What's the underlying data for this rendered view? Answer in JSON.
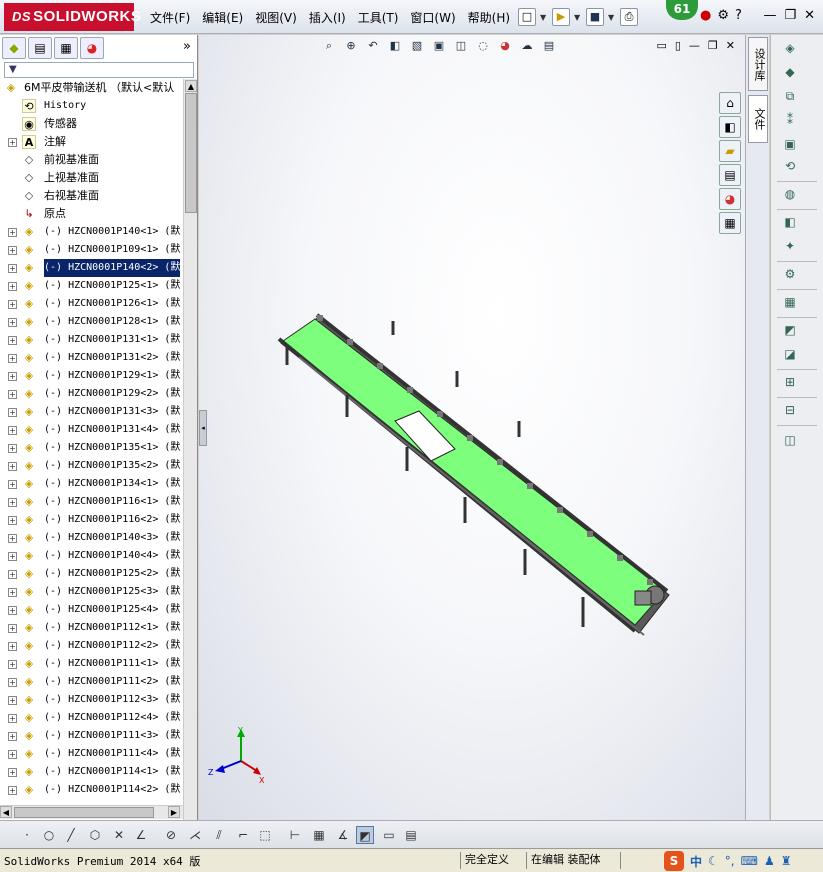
{
  "app": {
    "brand": "SOLIDWORKS",
    "brand_prefix": "DS"
  },
  "menus": [
    "文件(F)",
    "编辑(E)",
    "视图(V)",
    "插入(I)",
    "工具(T)",
    "窗口(W)",
    "帮助(H)"
  ],
  "badge": "61",
  "tree": {
    "root": "6M平皮带输送机 （默认<默认",
    "features": [
      {
        "icon": "history-icon",
        "label": "History"
      },
      {
        "icon": "sensor-icon",
        "label": "传感器"
      },
      {
        "icon": "annotation-icon",
        "label": "注解"
      },
      {
        "icon": "plane-icon",
        "label": "前视基准面"
      },
      {
        "icon": "plane-icon",
        "label": "上视基准面"
      },
      {
        "icon": "plane-icon",
        "label": "右视基准面"
      },
      {
        "icon": "origin-icon",
        "label": "原点"
      }
    ],
    "components": [
      "(-) HZCN0001P140<1> (默",
      "(-) HZCN0001P109<1> (默",
      "(-) HZCN0001P140<2> (默",
      "(-) HZCN0001P125<1> (默",
      "(-) HZCN0001P126<1> (默",
      "(-) HZCN0001P128<1> (默",
      "(-) HZCN0001P131<1> (默",
      "(-) HZCN0001P131<2> (默",
      "(-) HZCN0001P129<1> (默",
      "(-) HZCN0001P129<2> (默",
      "(-) HZCN0001P131<3> (默",
      "(-) HZCN0001P131<4> (默",
      "(-) HZCN0001P135<1> (默",
      "(-) HZCN0001P135<2> (默",
      "(-) HZCN0001P134<1> (默",
      "(-) HZCN0001P116<1> (默",
      "(-) HZCN0001P116<2> (默",
      "(-) HZCN0001P140<3> (默",
      "(-) HZCN0001P140<4> (默",
      "(-) HZCN0001P125<2> (默",
      "(-) HZCN0001P125<3> (默",
      "(-) HZCN0001P125<4> (默",
      "(-) HZCN0001P112<1> (默",
      "(-) HZCN0001P112<2> (默",
      "(-) HZCN0001P111<1> (默",
      "(-) HZCN0001P111<2> (默",
      "(-) HZCN0001P112<3> (默",
      "(-) HZCN0001P112<4> (默",
      "(-) HZCN0001P111<3> (默",
      "(-) HZCN0001P111<4> (默",
      "(-) HZCN0001P114<1> (默",
      "(-) HZCN0001P114<2> (默"
    ],
    "selected_index": 2
  },
  "right_tabs": {
    "tab1": "设计库",
    "tab2": "文件"
  },
  "triad": {
    "x": "X",
    "y": "Y",
    "z": "Z"
  },
  "status": {
    "app": "SolidWorks Premium 2014 x64 版",
    "state": "完全定义",
    "mode": "在编辑 装配体"
  },
  "ime": {
    "logo": "S",
    "lang": "中"
  },
  "colors": {
    "belt": "#7dff7d",
    "selection": "#0a246a",
    "brand": "#c8102e"
  }
}
